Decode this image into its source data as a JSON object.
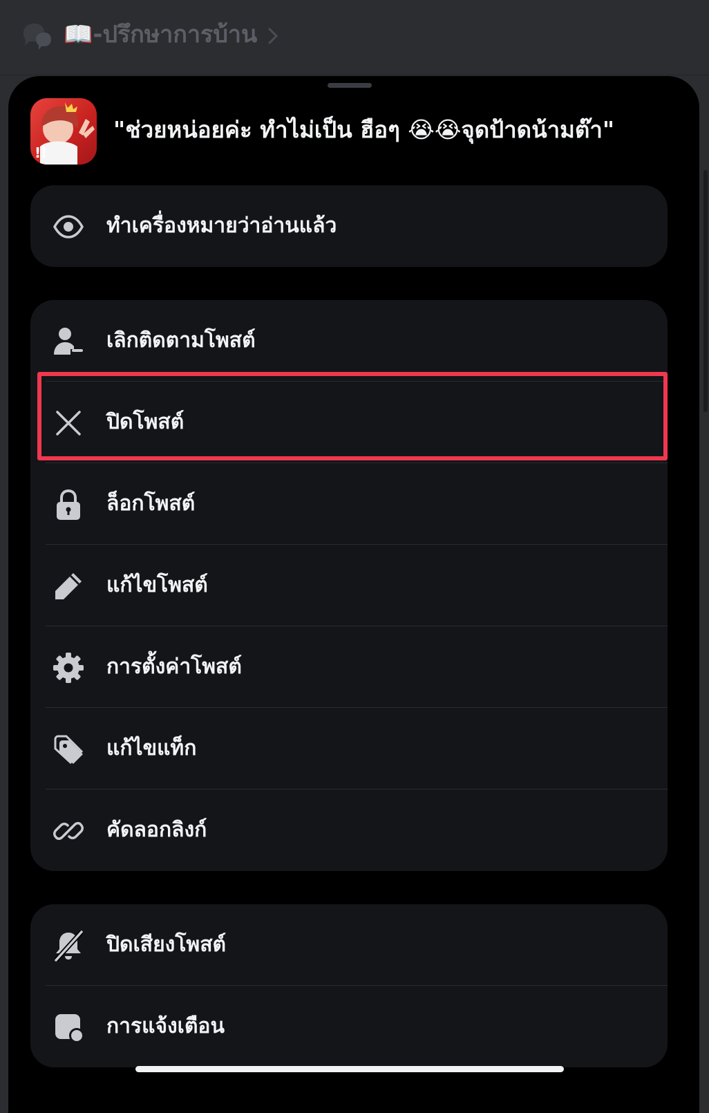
{
  "header": {
    "channel_name": "📖-ปรึกษาการบ้าน",
    "forum_icon": "forum-channel-icon",
    "chevron_icon": "chevron-right-icon"
  },
  "post": {
    "title": "\"ช่วยหน่อยค่ะ ทำไม่เป็น ฮือๆ 😭😭จุดป้าดน้ามต๊า\"",
    "avatar": "user-avatar"
  },
  "menu": {
    "group1": [
      {
        "label": "ทำเครื่องหมายว่าอ่านแล้ว",
        "icon": "eye-icon"
      }
    ],
    "group2": [
      {
        "label": "เลิกติดตามโพสต์",
        "icon": "unfollow-user-icon"
      },
      {
        "label": "ปิดโพสต์",
        "icon": "close-icon"
      },
      {
        "label": "ล็อกโพสต์",
        "icon": "lock-icon"
      },
      {
        "label": "แก้ไขโพสต์",
        "icon": "pencil-icon"
      },
      {
        "label": "การตั้งค่าโพสต์",
        "icon": "gear-icon"
      },
      {
        "label": "แก้ไขแท็ก",
        "icon": "tag-icon"
      },
      {
        "label": "คัดลอกลิงก์",
        "icon": "link-icon"
      }
    ],
    "group3": [
      {
        "label": "ปิดเสียงโพสต์",
        "icon": "bell-muted-icon"
      },
      {
        "label": "การแจ้งเตือน",
        "icon": "notification-icon"
      }
    ]
  },
  "colors": {
    "background": "#000000",
    "group_background": "#141519",
    "text": "#f2f3f5",
    "highlight": "#f0384f"
  }
}
